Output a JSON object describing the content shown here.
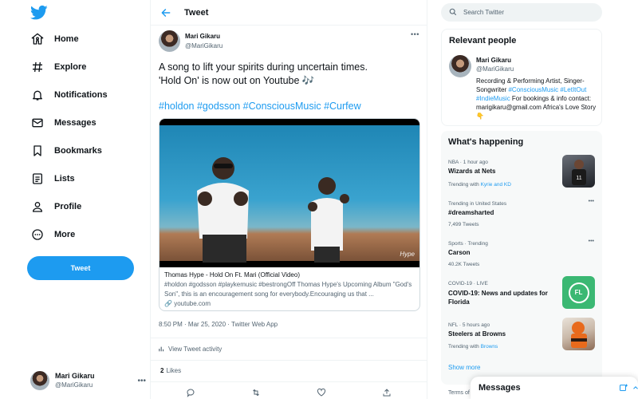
{
  "colors": {
    "accent": "#1d9bf0",
    "text": "#0f1419",
    "muted": "#536471"
  },
  "nav": {
    "items": [
      {
        "label": "Home",
        "icon": "home-icon"
      },
      {
        "label": "Explore",
        "icon": "hashtag-icon"
      },
      {
        "label": "Notifications",
        "icon": "bell-icon"
      },
      {
        "label": "Messages",
        "icon": "envelope-icon"
      },
      {
        "label": "Bookmarks",
        "icon": "bookmark-icon"
      },
      {
        "label": "Lists",
        "icon": "list-icon"
      },
      {
        "label": "Profile",
        "icon": "person-icon"
      },
      {
        "label": "More",
        "icon": "more-circle-icon"
      }
    ],
    "tweet_button": "Tweet",
    "account": {
      "name": "Mari Gikaru",
      "handle": "@MariGikaru"
    }
  },
  "header": {
    "title": "Tweet"
  },
  "tweet": {
    "author_name": "Mari Gikaru",
    "author_handle": "@MariGikaru",
    "text_line1": "A song to lift your spirits during uncertain times.",
    "text_line2": "'Hold On' is now out on Youtube 🎶",
    "hashtags": "#holdon #godsson #ConsciousMusic #Curfew",
    "card": {
      "title": "Thomas Hype - Hold On Ft. Mari (Official Video)",
      "description": "#holdon #godsson #playkemusic #bestrongOff Thomas Hype's Upcoming Album \"God's Son\", this is an encouragement song for everybody.Encouraging us that ...",
      "url": "youtube.com",
      "watermark": "Hype"
    },
    "meta": "8:50 PM · Mar 25, 2020 · Twitter Web App",
    "activity": "View Tweet activity",
    "likes_count": "2",
    "likes_label": "Likes"
  },
  "search": {
    "placeholder": "Search Twitter"
  },
  "relevant": {
    "title": "Relevant people",
    "name": "Mari Gikaru",
    "handle": "@MariGikaru",
    "bio_part1": "Recording & Performing Artist, Singer-Songwriter ",
    "bio_tags": "#ConsciousMusic #LetItOut #IndieMusic",
    "bio_part2": " For bookings & info contact: marigikaru@gmail.com Africa's Love Story 👇"
  },
  "happening": {
    "title": "What's happening",
    "trends": [
      {
        "context": "NBA · 1 hour ago",
        "name": "Wizards at Nets",
        "sub_prefix": "Trending with ",
        "sub_link": "Kyrie and KD",
        "thumb": "basketball-player-thumb"
      },
      {
        "context": "Trending in United States",
        "name": "#dreamsharted",
        "sub_prefix": "7,499 Tweets",
        "sub_link": "",
        "thumb": ""
      },
      {
        "context": "Sports · Trending",
        "name": "Carson",
        "sub_prefix": "40.2K Tweets",
        "sub_link": "",
        "thumb": ""
      },
      {
        "context": "COVID-19 · LIVE",
        "name": "COVID-19: News and updates for Florida",
        "sub_prefix": "",
        "sub_link": "",
        "thumb": "florida-badge-thumb",
        "thumb_text": "FL"
      },
      {
        "context": "NFL · 5 hours ago",
        "name": "Steelers at Browns",
        "sub_prefix": "Trending with ",
        "sub_link": "Browns",
        "thumb": "football-player-thumb"
      }
    ],
    "show_more": "Show more"
  },
  "footer": {
    "terms": "Terms of"
  },
  "messages_drawer": {
    "title": "Messages"
  }
}
